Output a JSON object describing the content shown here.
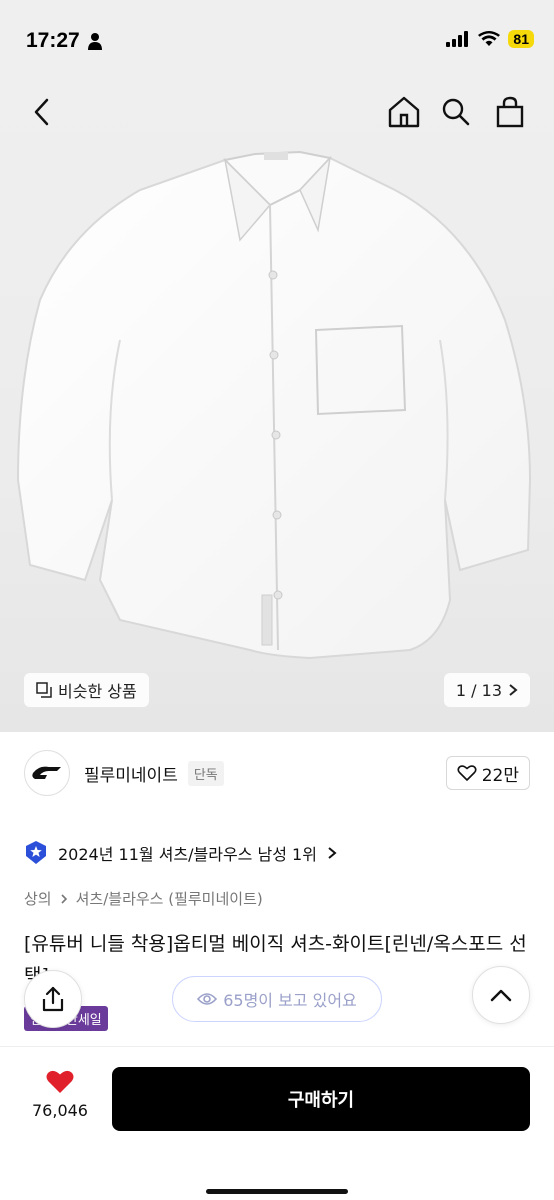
{
  "status": {
    "time": "17:27",
    "battery": "81",
    "icons": [
      "person-icon",
      "signal-icon",
      "wifi-icon"
    ]
  },
  "header": {
    "icons": [
      "back-icon",
      "home-icon",
      "search-icon",
      "shopping-bag-icon"
    ]
  },
  "gallery": {
    "similar_label": "비슷한 상품",
    "page_indicator": "1 / 13"
  },
  "brand": {
    "name": "필루미네이트",
    "tag": "단독",
    "likes": "22만"
  },
  "ranking": {
    "text": "2024년 11월 셔츠/블라우스 남성 1위"
  },
  "category": {
    "level1": "상의",
    "level2": "셔츠/블라우스 (필루미네이트)"
  },
  "product": {
    "title": "[유튜버 니들 착용]옵티멀 베이직 셔츠-화이트[린넨/옥스포드 선택]",
    "badge": "연말결산세일"
  },
  "overlay": {
    "viewers": "65명이 보고 있어요"
  },
  "footer": {
    "wish_count": "76,046",
    "buy_label": "구매하기"
  },
  "colors": {
    "heart": "#e0202b",
    "badge": "#6a3b9b",
    "battery": "#f5d90a",
    "buy_button": "#000000"
  }
}
